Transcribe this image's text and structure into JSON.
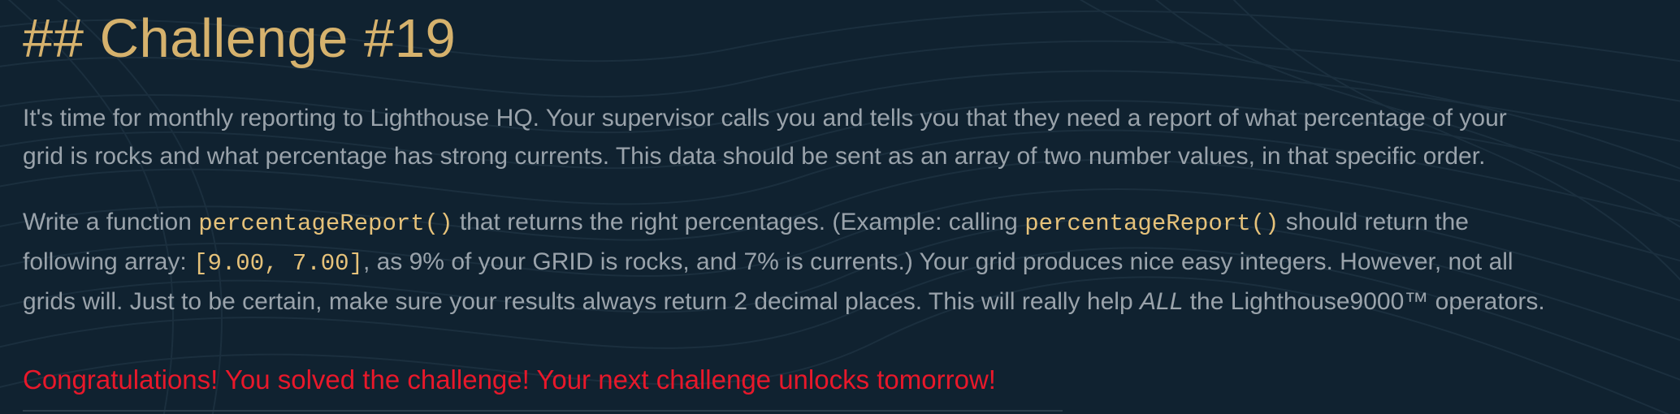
{
  "challenge": {
    "title": "## Challenge #19",
    "intro": {
      "line1": "It's time for monthly reporting to Lighthouse HQ. Your supervisor calls you and tells you that they need a report of what percentage of your",
      "line2": "grid is rocks and what percentage has strong currents. This data should be sent as an array of two number values, in that specific order."
    },
    "task": {
      "l1_a": "Write a function ",
      "l1_code1": "percentageReport()",
      "l1_b": " that returns the right percentages. (Example: calling ",
      "l1_code2": "percentageReport()",
      "l1_c": " should return the",
      "l2_a": "following array: ",
      "l2_code": "[9.00, 7.00]",
      "l2_b": ", as 9% of your GRID is rocks, and 7% is currents.) Your grid produces nice easy integers. However, not all",
      "l3_a": "grids will. Just to be certain, make sure your results always return 2 decimal places. This will really help ",
      "l3_em": "ALL",
      "l3_b": " the Lighthouse9000™ operators."
    },
    "success_message": "Congratulations! You solved the challenge! Your next challenge unlocks tomorrow!"
  },
  "colors": {
    "background": "#102230",
    "heading": "#d6b26d",
    "body_text": "#9aa3ab",
    "code": "#e6c27a",
    "success": "#e8182a"
  }
}
